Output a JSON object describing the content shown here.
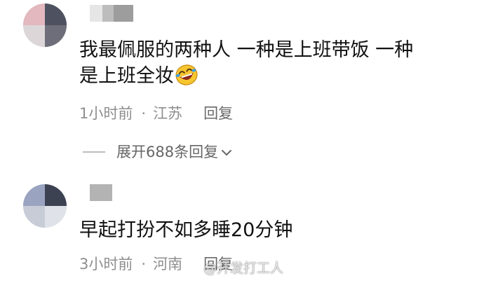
{
  "comments": [
    {
      "text_line1": "我最佩服的两种人 一种是上班带饭 一种",
      "text_line2": "是上班全妆",
      "emoji": "rolling-on-floor-laughing-emoji",
      "time": "1小时前",
      "separator": "·",
      "location": "江苏",
      "reply_label": "回复",
      "expand_label": "展开688条回复"
    },
    {
      "text": "早起打扮不如多睡20分钟",
      "time": "3小时前",
      "separator": "·",
      "location": "河南",
      "reply_label": "回复"
    }
  ],
  "watermark": "@开发打工人",
  "colors": {
    "text": "#111111",
    "meta": "#8e8e8e",
    "expand": "#666666"
  }
}
